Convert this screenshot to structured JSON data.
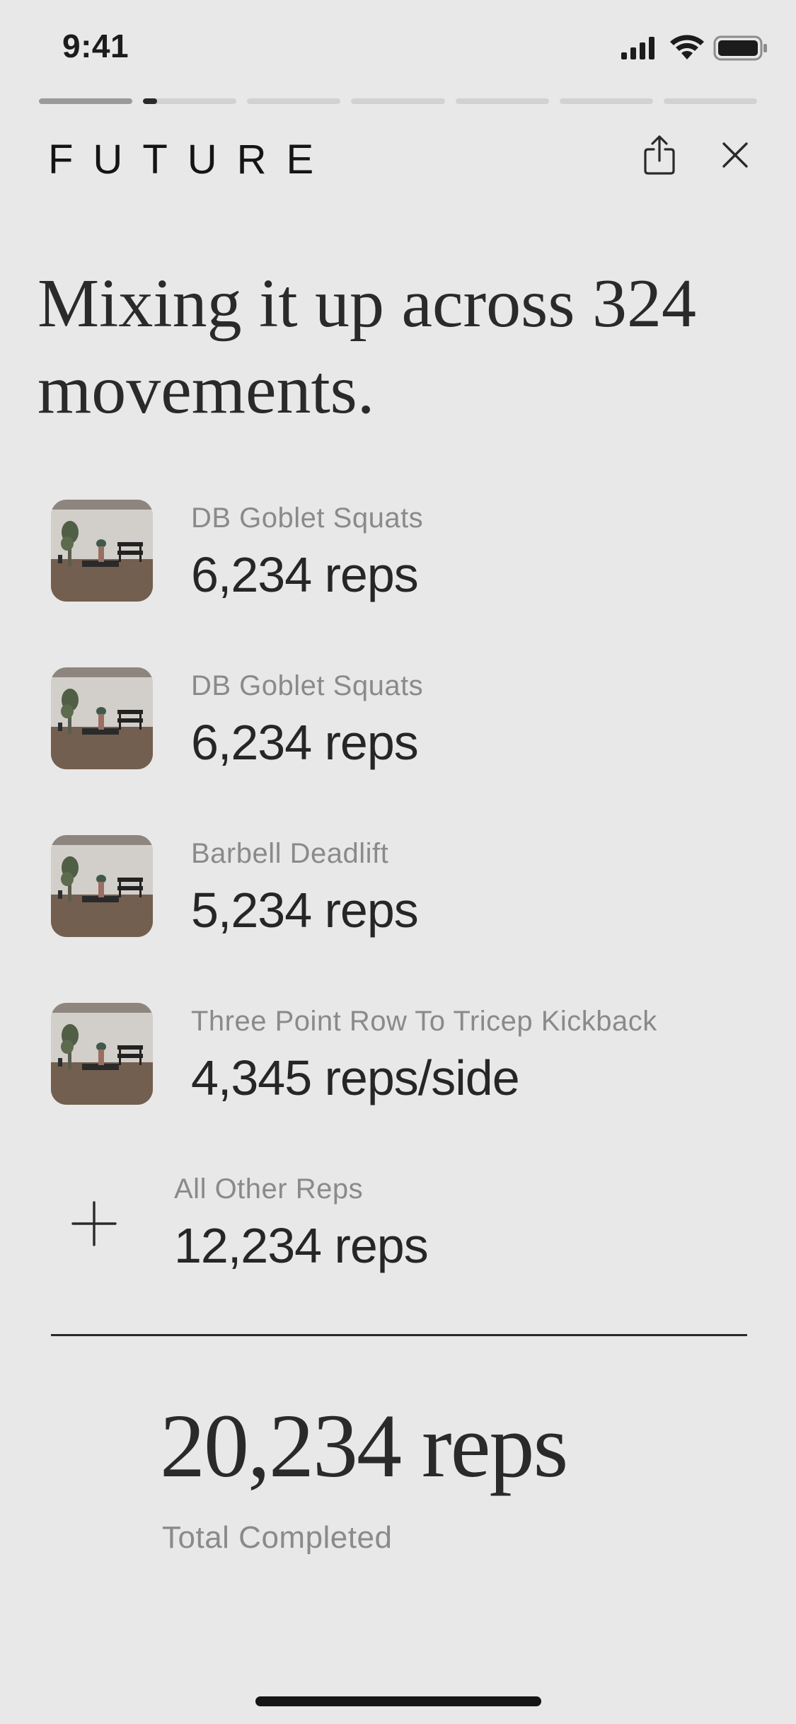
{
  "status_bar": {
    "time": "9:41",
    "icons": [
      "cellular-signal-icon",
      "wifi-icon",
      "battery-icon"
    ]
  },
  "progress": {
    "segments": 7,
    "current_index": 1,
    "current_fraction": 0.15,
    "completed_color": "#9a9a9a",
    "current_color": "#2a2a2a",
    "pending_color": "#d2d2d2"
  },
  "header": {
    "logo": "FUTURE",
    "share_icon": "share-icon",
    "close_icon": "close-icon"
  },
  "headline": "Mixing it up across 324 movements.",
  "movements": [
    {
      "name": "DB Goblet Squats",
      "value": "6,234 reps"
    },
    {
      "name": "DB Goblet Squats",
      "value": "6,234 reps"
    },
    {
      "name": "Barbell Deadlift",
      "value": "5,234 reps"
    },
    {
      "name": "Three Point Row To Tricep Kickback",
      "value": "4,345 reps/side"
    }
  ],
  "other": {
    "icon": "plus-icon",
    "label": "All Other Reps",
    "value": "12,234 reps"
  },
  "total": {
    "value": "20,234 reps",
    "label": "Total Completed"
  },
  "colors": {
    "background": "#e8e8e8",
    "text_primary": "#2a2a2a",
    "text_secondary": "#8a8a8a"
  }
}
